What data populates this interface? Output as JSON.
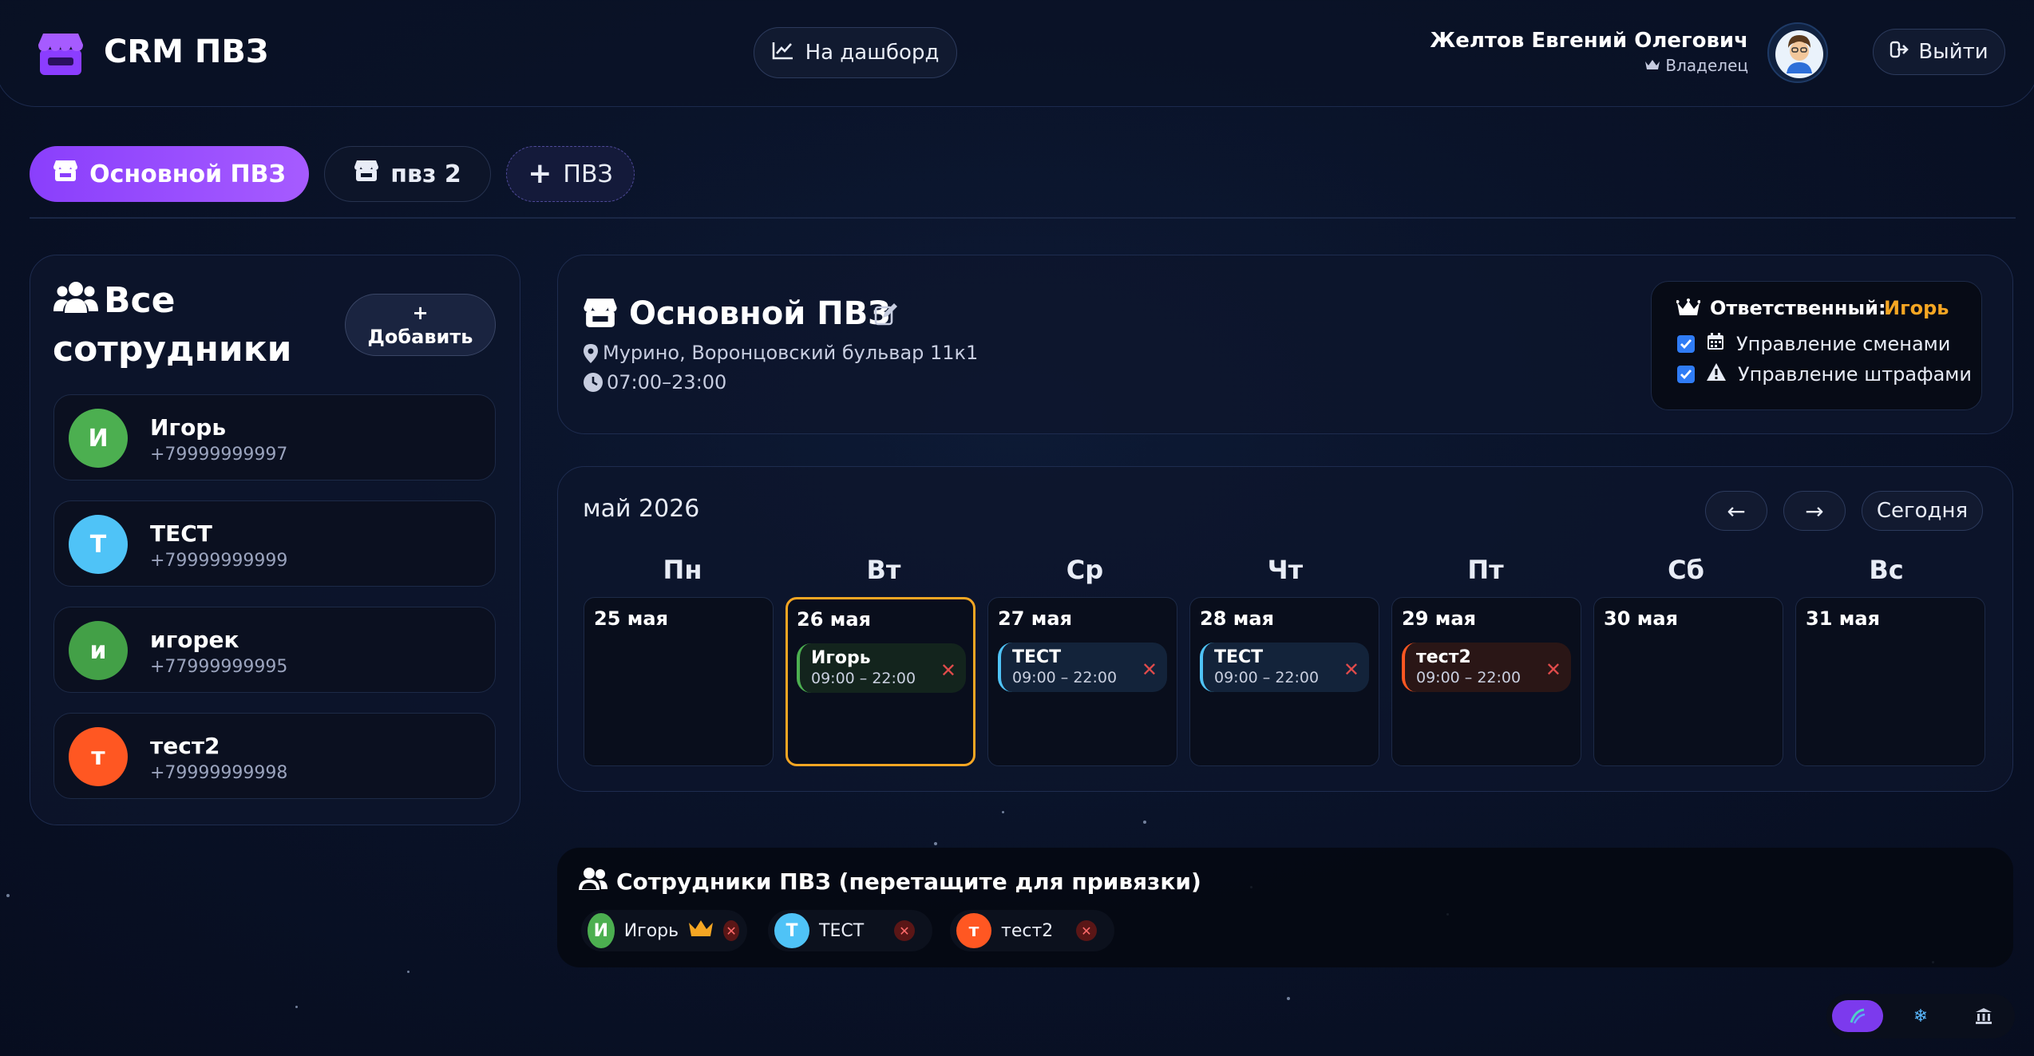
{
  "app": {
    "title": "CRM ПВЗ"
  },
  "header": {
    "dashboard_label": "На дашборд",
    "user_name": "Желтов Евгений Олегович",
    "user_role": "Владелец",
    "logout_label": "Выйти"
  },
  "tabs": [
    {
      "label": "Основной ПВЗ",
      "active": true
    },
    {
      "label": "пвз 2",
      "active": false
    },
    {
      "label": "ПВЗ",
      "active": false
    }
  ],
  "employees_panel": {
    "title_line1": "Все",
    "title_line2": "сотрудники",
    "add_label_top": "+",
    "add_label": "Добавить",
    "items": [
      {
        "initial": "И",
        "name": "Игорь",
        "phone": "+79999999997",
        "color": "#4caf50"
      },
      {
        "initial": "Т",
        "name": "ТЕСТ",
        "phone": "+79999999999",
        "color": "#4fc3f7"
      },
      {
        "initial": "и",
        "name": "игорек",
        "phone": "+77999999995",
        "color": "#43a047"
      },
      {
        "initial": "т",
        "name": "тест2",
        "phone": "+79999999998",
        "color": "#ff5722"
      }
    ]
  },
  "pvz": {
    "name": "Основной ПВЗ",
    "address": "Мурино, Воронцовский бульвар 11к1",
    "hours": "07:00–23:00",
    "responsible_label": "Ответственный:",
    "responsible_name": "Игорь",
    "permissions": [
      {
        "label": "Управление сменами",
        "checked": true
      },
      {
        "label": "Управление штрафами",
        "checked": true
      }
    ]
  },
  "calendar": {
    "month": "май 2026",
    "prev_label": "←",
    "next_label": "→",
    "today_label": "Сегодня",
    "weekdays": [
      "Пн",
      "Вт",
      "Ср",
      "Чт",
      "Пт",
      "Сб",
      "Вс"
    ],
    "days": [
      {
        "label": "25 мая",
        "today": false,
        "shift": null
      },
      {
        "label": "26 мая",
        "today": true,
        "shift": {
          "name": "Игорь",
          "time": "09:00 – 22:00",
          "color": "#4caf50",
          "bg": "#13241d"
        }
      },
      {
        "label": "27 мая",
        "today": false,
        "shift": {
          "name": "ТЕСТ",
          "time": "09:00 – 22:00",
          "color": "#4fc3f7",
          "bg": "#13233a"
        }
      },
      {
        "label": "28 мая",
        "today": false,
        "shift": {
          "name": "ТЕСТ",
          "time": "09:00 – 22:00",
          "color": "#4fc3f7",
          "bg": "#13233a"
        }
      },
      {
        "label": "29 мая",
        "today": false,
        "shift": {
          "name": "тест2",
          "time": "09:00 – 22:00",
          "color": "#ff5722",
          "bg": "#2a1616"
        }
      },
      {
        "label": "30 мая",
        "today": false,
        "shift": null
      },
      {
        "label": "31 мая",
        "today": false,
        "shift": null
      }
    ],
    "remove_glyph": "✕"
  },
  "pvz_staff": {
    "title": "Сотрудники ПВЗ (перетащите для привязки)",
    "remove_glyph": "✕",
    "items": [
      {
        "initial": "И",
        "name": "Игорь",
        "color": "#4caf50",
        "owner": true
      },
      {
        "initial": "Т",
        "name": "ТЕСТ",
        "color": "#4fc3f7",
        "owner": false
      },
      {
        "initial": "т",
        "name": "тест2",
        "color": "#ff5722",
        "owner": false
      }
    ]
  },
  "theme_switcher": {
    "icons": [
      "aurora-icon",
      "snowflake-icon",
      "bank-icon"
    ],
    "active_color": "#7c3aed"
  }
}
